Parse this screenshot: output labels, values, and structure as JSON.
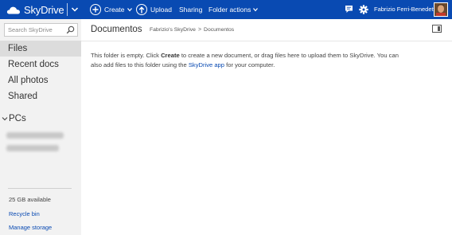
{
  "header": {
    "brand": "SkyDrive",
    "create_label": "Create",
    "upload_label": "Upload",
    "sharing_label": "Sharing",
    "folder_actions_label": "Folder actions",
    "username": "Fabrizio Ferri-Benedetti",
    "accent_color": "#094ab2"
  },
  "sidebar": {
    "search_placeholder": "Search SkyDrive",
    "items": [
      {
        "label": "Files",
        "selected": true
      },
      {
        "label": "Recent docs",
        "selected": false
      },
      {
        "label": "All photos",
        "selected": false
      },
      {
        "label": "Shared",
        "selected": false
      }
    ],
    "pcs_label": "PCs",
    "storage_text": "25 GB available",
    "recycle_bin": "Recycle bin",
    "manage_storage": "Manage storage"
  },
  "main": {
    "title": "Documentos",
    "breadcrumb": [
      "Fabrizio's SkyDrive",
      "Documentos"
    ],
    "breadcrumb_sep": ">",
    "empty_message": {
      "part1": "This folder is empty. Click ",
      "create_word": "Create",
      "part2": " to create a new document, or drag files here to upload them to SkyDrive. You can also add files to this folder using the ",
      "app_link": "SkyDrive app",
      "part3": " for your computer."
    }
  },
  "icons": {
    "brand": "cloud-icon",
    "create": "plus-circle-icon",
    "upload": "upload-circle-icon",
    "messages": "chat-icon",
    "settings": "gear-icon"
  }
}
